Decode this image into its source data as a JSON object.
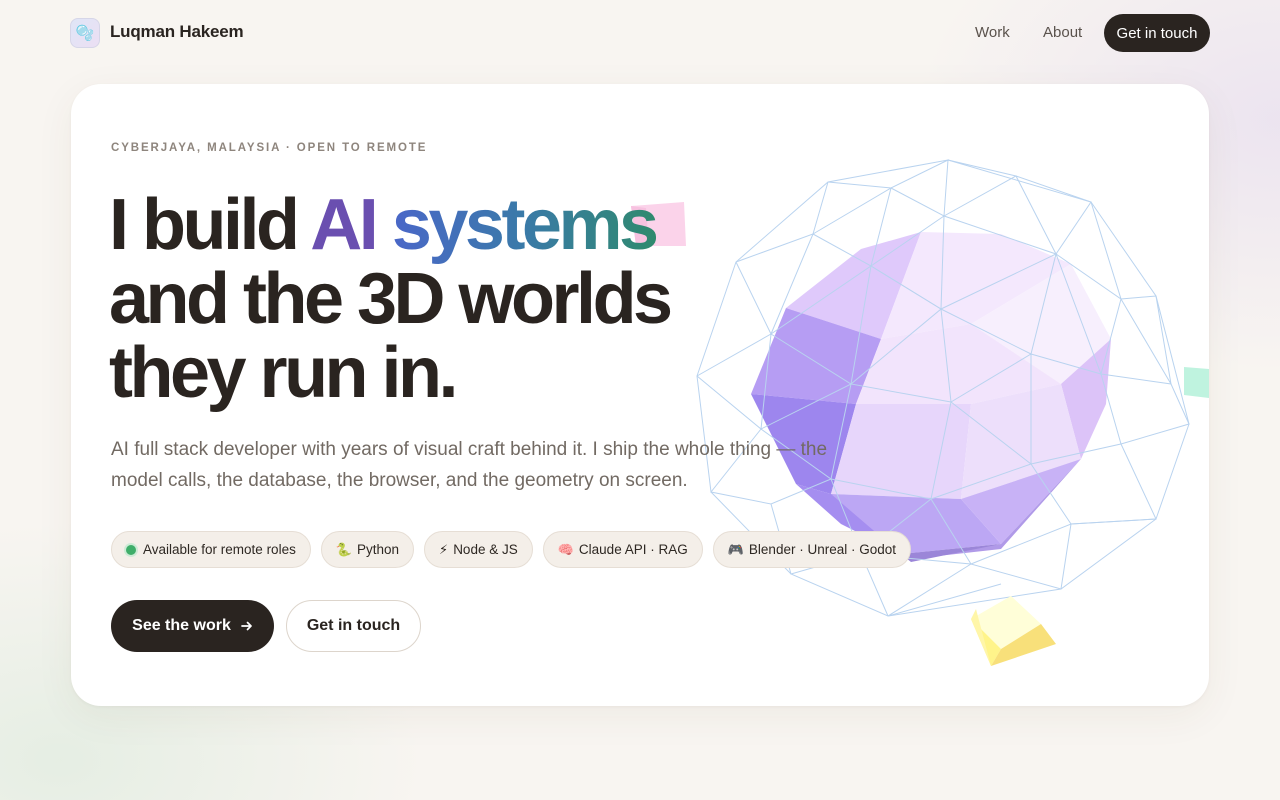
{
  "brand": {
    "name": "Luqman Hakeem",
    "logo_icon": "bubbles-icon"
  },
  "nav": {
    "work": "Work",
    "about": "About",
    "cta": "Get in touch"
  },
  "hero": {
    "eyebrow": "CYBERJAYA, MALAYSIA · OPEN TO REMOTE",
    "headline_line1_prefix": "I build ",
    "headline_ai": "AI",
    "headline_systems": "systems",
    "headline_line2": "and the 3D worlds",
    "headline_line3": "they run in.",
    "lead": "AI full stack developer with years of visual craft behind it. I ship the whole thing — the model calls, the database, the browser, and the geometry on screen.",
    "tags": [
      {
        "icon": "status-dot",
        "label": "Available for remote roles"
      },
      {
        "icon": "🐍",
        "label": "Python"
      },
      {
        "icon": "⚡",
        "label": "Node & JS"
      },
      {
        "icon": "🧠",
        "label": "Claude API · RAG"
      },
      {
        "icon": "🎮",
        "label": "Blender · Unreal · Godot"
      }
    ],
    "primary_button": "See the work",
    "primary_button_icon": "arrow-right-icon",
    "secondary_button": "Get in touch"
  },
  "colors": {
    "ink": "#2a2420",
    "accent_purple": "#6a4fb0",
    "accent_teal": "#2f8a6e",
    "status_green": "#3fae6a",
    "card_bg": "#ffffff",
    "page_bg": "#f8f5f1"
  }
}
